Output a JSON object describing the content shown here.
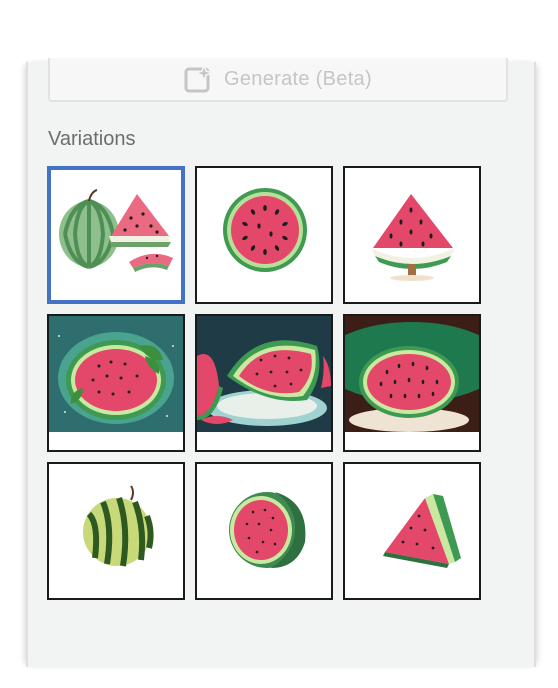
{
  "generate_button": {
    "label": "Generate (Beta)",
    "icon": "sparkle-icon"
  },
  "variations": {
    "title": "Variations",
    "selected_index": 0,
    "items": [
      {
        "subject": "watermelon-whole-and-slices-icon"
      },
      {
        "subject": "watermelon-round-slice-icon"
      },
      {
        "subject": "watermelon-wedge-tree-icon"
      },
      {
        "subject": "watermelon-half-leaves-icon"
      },
      {
        "subject": "watermelon-slices-on-plate-icon"
      },
      {
        "subject": "watermelon-half-dark-icon"
      },
      {
        "subject": "watermelon-striped-whole-icon"
      },
      {
        "subject": "watermelon-halved-icon"
      },
      {
        "subject": "watermelon-wedge-icon"
      }
    ]
  },
  "colors": {
    "selected_border": "#4472c4",
    "flesh": "#e44a6a",
    "rind": "#3a8a4e",
    "seed": "#1e1e1e"
  }
}
